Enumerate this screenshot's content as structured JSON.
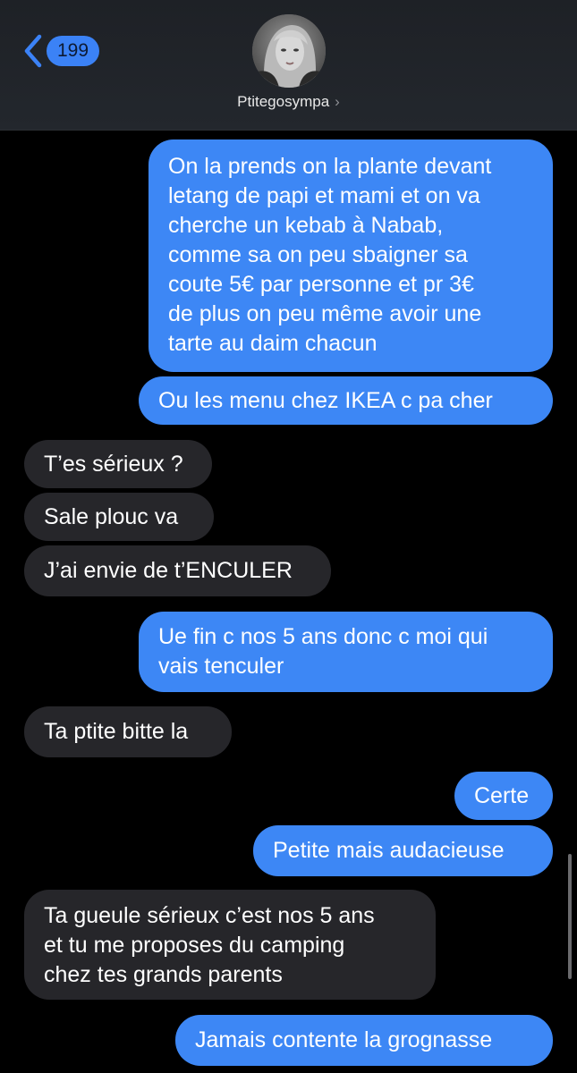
{
  "header": {
    "unread_count": "199",
    "contact_name": "Ptitegosympa",
    "contact_chevron": "›"
  },
  "messages": [
    {
      "direction": "out",
      "text": "On la prends on la plante devant\nletang de papi et mami et on va\ncherche un kebab à Nabab,\ncomme sa on peu sbaigner sa\ncoute 5€ par personne et pr 3€\nde plus on peu même avoir une\ntarte au daim chacun"
    },
    {
      "direction": "out",
      "text": "Ou les menu chez IKEA c pa cher"
    },
    {
      "direction": "in",
      "text": "T’es sérieux ?"
    },
    {
      "direction": "in",
      "text": "Sale plouc va"
    },
    {
      "direction": "in",
      "text": "J’ai envie de t’ENCULER"
    },
    {
      "direction": "out",
      "text": "Ue fin c nos 5 ans donc c moi qui\nvais tenculer"
    },
    {
      "direction": "in",
      "text": "Ta ptite bitte la"
    },
    {
      "direction": "out",
      "text": "Certe"
    },
    {
      "direction": "out",
      "text": "Petite mais audacieuse"
    },
    {
      "direction": "in",
      "text": "Ta gueule sérieux c’est nos 5 ans\net tu me proposes du camping\nchez tes grands parents"
    },
    {
      "direction": "out",
      "text": "Jamais contente la grognasse"
    }
  ],
  "colors": {
    "outgoing_bubble": "#3d87f5",
    "incoming_bubble": "#26262a",
    "background": "#000000",
    "header_background": "#1e2126",
    "badge": "#3b82f6"
  },
  "icons": {
    "back": "chevron-left-icon",
    "contact_more": "chevron-right-icon"
  }
}
